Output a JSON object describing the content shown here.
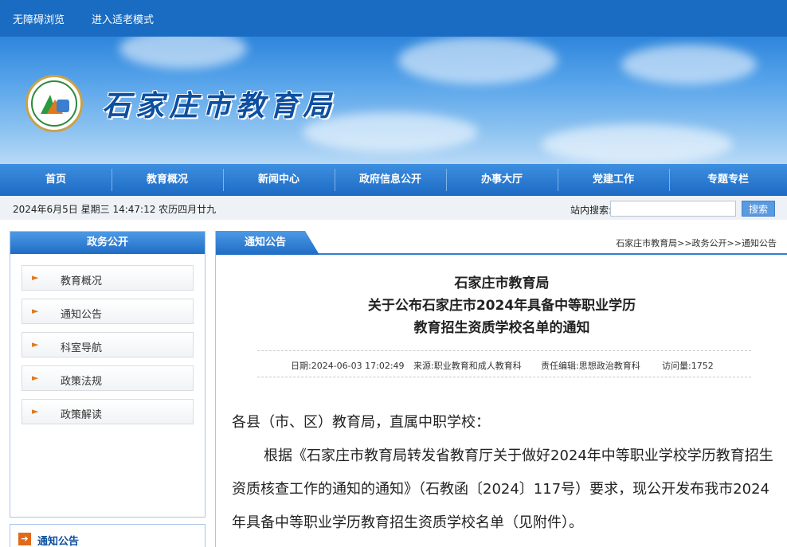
{
  "topbar": {
    "accessibility": "无障碍浏览",
    "elder_mode": "进入适老模式"
  },
  "site": {
    "title": "石家庄市教育局"
  },
  "nav": [
    "首页",
    "教育概况",
    "新闻中心",
    "政府信息公开",
    "办事大厅",
    "党建工作",
    "专题专栏"
  ],
  "datebar": {
    "date": "2024年6月5日 星期三 14:47:12 农历四月廿九",
    "search_label": "站内搜索:",
    "search_button": "搜索"
  },
  "sidebar": {
    "heading": "政务公开",
    "items": [
      "教育概况",
      "通知公告",
      "科室导航",
      "政策法规",
      "政策解读"
    ],
    "section2": "通知公告"
  },
  "main": {
    "tab": "通知公告",
    "breadcrumb": "石家庄市教育局>>政务公开>>通知公告",
    "title_lines": [
      "石家庄市教育局",
      "关于公布石家庄市2024年具备中等职业学历",
      "教育招生资质学校名单的通知"
    ],
    "meta": {
      "date": "日期:2024-06-03 17:02:49",
      "source": "来源:职业教育和成人教育科",
      "editor": "责任编辑:思想政治教育科",
      "visits": "访问量:1752"
    },
    "body": {
      "salutation": "各县（市、区）教育局，直属中职学校：",
      "paragraph": "根据《石家庄市教育局转发省教育厅关于做好2024年中等职业学校学历教育招生资质核查工作的通知的通知》（石教函〔2024〕117号）要求，现公开发布我市2024年具备中等职业学历教育招生资质学校名单（见附件）。"
    }
  }
}
